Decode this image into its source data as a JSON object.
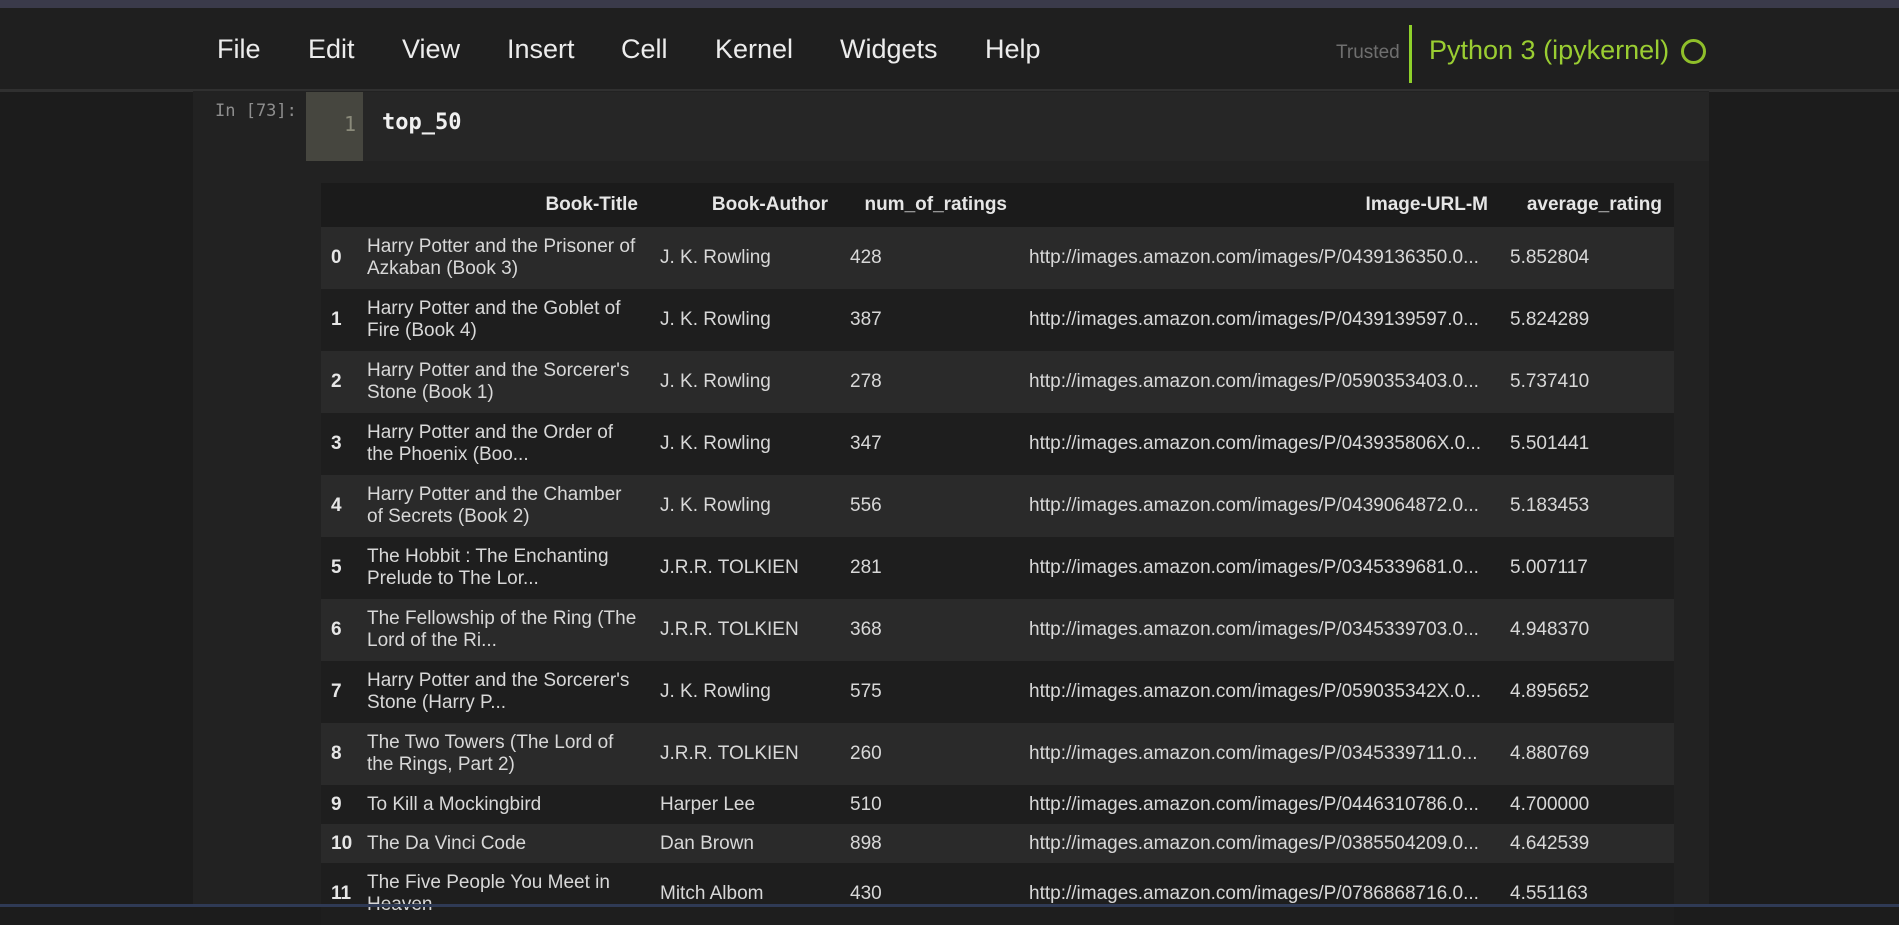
{
  "menu": [
    "File",
    "Edit",
    "View",
    "Insert",
    "Cell",
    "Kernel",
    "Widgets",
    "Help"
  ],
  "status": {
    "trusted": "Trusted",
    "kernel": "Python 3 (ipykernel)"
  },
  "cell": {
    "prompt": "In [73]:",
    "line_number": "1",
    "code": "top_50"
  },
  "table": {
    "columns": [
      "",
      "Book-Title",
      "Book-Author",
      "num_of_ratings",
      "Image-URL-M",
      "average_rating"
    ],
    "rows": [
      {
        "idx": "0",
        "title": "Harry Potter and the Prisoner of Azkaban (Book 3)",
        "author": "J. K. Rowling",
        "num": "428",
        "url": "http://images.amazon.com/images/P/0439136350.0...",
        "avg": "5.852804",
        "size": "tall"
      },
      {
        "idx": "1",
        "title": "Harry Potter and the Goblet of Fire (Book 4)",
        "author": "J. K. Rowling",
        "num": "387",
        "url": "http://images.amazon.com/images/P/0439139597.0...",
        "avg": "5.824289",
        "size": "tall"
      },
      {
        "idx": "2",
        "title": "Harry Potter and the Sorcerer's Stone (Book 1)",
        "author": "J. K. Rowling",
        "num": "278",
        "url": "http://images.amazon.com/images/P/0590353403.0...",
        "avg": "5.737410",
        "size": "tall"
      },
      {
        "idx": "3",
        "title": "Harry Potter and the Order of the Phoenix (Boo...",
        "author": "J. K. Rowling",
        "num": "347",
        "url": "http://images.amazon.com/images/P/043935806X.0...",
        "avg": "5.501441",
        "size": "tall"
      },
      {
        "idx": "4",
        "title": "Harry Potter and the Chamber of Secrets (Book 2)",
        "author": "J. K. Rowling",
        "num": "556",
        "url": "http://images.amazon.com/images/P/0439064872.0...",
        "avg": "5.183453",
        "size": "tall"
      },
      {
        "idx": "5",
        "title": "The Hobbit : The Enchanting Prelude to The Lor...",
        "author": "J.R.R. TOLKIEN",
        "num": "281",
        "url": "http://images.amazon.com/images/P/0345339681.0...",
        "avg": "5.007117",
        "size": "tall"
      },
      {
        "idx": "6",
        "title": "The Fellowship of the Ring (The Lord of the Ri...",
        "author": "J.R.R. TOLKIEN",
        "num": "368",
        "url": "http://images.amazon.com/images/P/0345339703.0...",
        "avg": "4.948370",
        "size": "tall"
      },
      {
        "idx": "7",
        "title": "Harry Potter and the Sorcerer's Stone (Harry P...",
        "author": "J. K. Rowling",
        "num": "575",
        "url": "http://images.amazon.com/images/P/059035342X.0...",
        "avg": "4.895652",
        "size": "tall"
      },
      {
        "idx": "8",
        "title": "The Two Towers (The Lord of the Rings, Part 2)",
        "author": "J.R.R. TOLKIEN",
        "num": "260",
        "url": "http://images.amazon.com/images/P/0345339711.0...",
        "avg": "4.880769",
        "size": "tall"
      },
      {
        "idx": "9",
        "title": "To Kill a Mockingbird",
        "author": "Harper Lee",
        "num": "510",
        "url": "http://images.amazon.com/images/P/0446310786.0...",
        "avg": "4.700000",
        "size": "short"
      },
      {
        "idx": "10",
        "title": "The Da Vinci Code",
        "author": "Dan Brown",
        "num": "898",
        "url": "http://images.amazon.com/images/P/0385504209.0...",
        "avg": "4.642539",
        "size": "short"
      },
      {
        "idx": "11",
        "title": "The Five People You Meet in Heaven",
        "author": "Mitch Albom",
        "num": "430",
        "url": "http://images.amazon.com/images/P/0786868716.0...",
        "avg": "4.551163",
        "size": "tall"
      }
    ]
  }
}
